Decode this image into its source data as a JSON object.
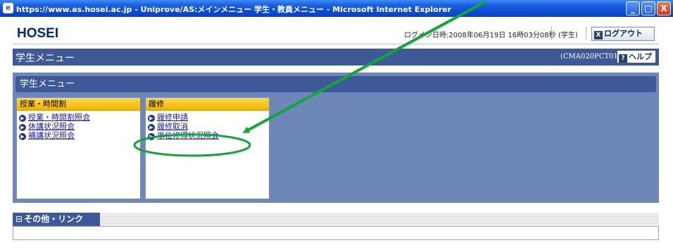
{
  "window": {
    "title": "https://www.as.hosei.ac.jp - Uniprove/AS:メインメニュー 学生・教員メニュー - Microsoft Internet Explorer",
    "icon_glyph": "e",
    "minimize_glyph": "_",
    "maximize_glyph": "□",
    "close_glyph": "X"
  },
  "header": {
    "logo": "HOSEI",
    "login_info": "ログイン日時:2008年06月19日 16時03分08秒",
    "role": "(学生)",
    "logout_icon": "X",
    "logout_label": "ログアウト"
  },
  "page": {
    "title": "学生メニュー",
    "screen_code": "(CMA020PCT01)",
    "help_icon": "?",
    "help_label": "ヘルプ"
  },
  "menu": {
    "panel_title": "学生メニュー",
    "groups": [
      {
        "title": "授業・時間割",
        "items": [
          "授業・時間割照会",
          "休講状況照会",
          "補講状況照会"
        ]
      },
      {
        "title": "履修",
        "items": [
          "履修申請",
          "履修取消",
          "単位修得状況照会"
        ]
      }
    ]
  },
  "links": {
    "icon": "⊟",
    "title": "その他・リンク"
  },
  "colors": {
    "titlebar": "#0a4bd1",
    "navy": "#3e5998",
    "panel_bg": "#6d87b9",
    "group_header": "#f0b400",
    "annotation_green": "#12a538"
  },
  "icons": {
    "menu_item": "arrow-circle-icon",
    "annotation": "green-arrow-and-ellipse"
  }
}
